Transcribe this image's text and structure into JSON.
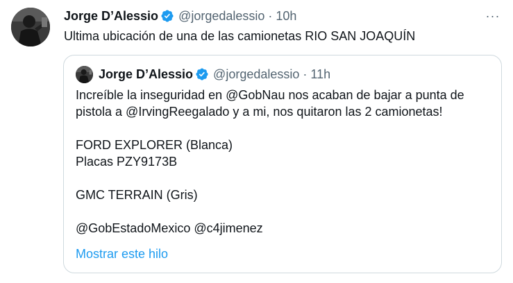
{
  "tweet": {
    "author_name": "Jorge D’Alessio",
    "handle": "@jorgedalessio",
    "separator": "·",
    "time": "10h",
    "text": "Ultima ubicación de una de las camionetas RIO SAN JOAQUÍN",
    "more_icon": "more-horizontal-icon",
    "more_label": "···"
  },
  "quoted_tweet": {
    "author_name": "Jorge D’Alessio",
    "handle": "@jorgedalessio",
    "separator": "·",
    "time": "11h",
    "lines": [
      "Increíble la inseguridad en @GobNau nos acaban de bajar a punta de",
      "pistola a @IrvingReegalado y a mi, nos quitaron las 2 camionetas!",
      "",
      "FORD EXPLORER (Blanca)",
      "Placas PZY9173B",
      "",
      "GMC TERRAIN (Gris)",
      "",
      "@GobEstadoMexico @c4jimenez"
    ],
    "show_thread": "Mostrar este hilo"
  },
  "colors": {
    "text": "#0f1419",
    "secondary": "#536471",
    "link": "#1d9bf0",
    "border": "#cfd9de",
    "verified": "#1d9bf0"
  }
}
